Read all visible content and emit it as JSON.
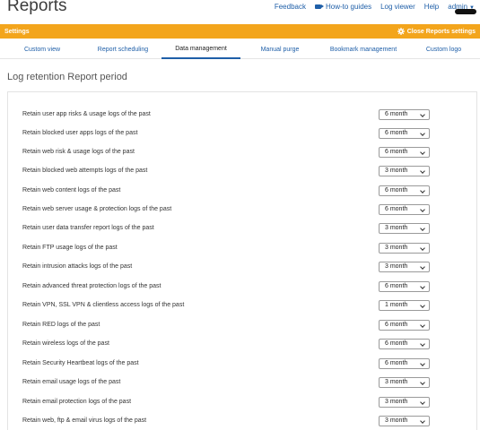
{
  "header": {
    "title": "Reports",
    "nav": {
      "feedback": "Feedback",
      "guides": "How-to guides",
      "log_viewer": "Log viewer",
      "help": "Help",
      "admin": "admin"
    }
  },
  "settings_bar": {
    "label": "Settings",
    "close_label": "Close Reports settings"
  },
  "tabs": [
    {
      "label": "Custom view"
    },
    {
      "label": "Report scheduling"
    },
    {
      "label": "Data management"
    },
    {
      "label": "Manual purge"
    },
    {
      "label": "Bookmark management"
    },
    {
      "label": "Custom logo"
    }
  ],
  "active_tab": "Data management",
  "section_title": "Log retention Report period",
  "retention_rows": [
    {
      "label": "Retain user app risks & usage logs of the past",
      "value": "6 month"
    },
    {
      "label": "Retain blocked user apps logs of the past",
      "value": "6 month"
    },
    {
      "label": "Retain web risk & usage logs of the past",
      "value": "6 month"
    },
    {
      "label": "Retain blocked web attempts logs of the past",
      "value": "3 month"
    },
    {
      "label": "Retain web content logs of the past",
      "value": "6 month"
    },
    {
      "label": "Retain web server usage & protection logs of the past",
      "value": "6 month"
    },
    {
      "label": "Retain user data transfer report logs of the past",
      "value": "3 month"
    },
    {
      "label": "Retain FTP usage logs of the past",
      "value": "3 month"
    },
    {
      "label": "Retain intrusion attacks logs of the past",
      "value": "3 month"
    },
    {
      "label": "Retain advanced threat protection logs of the past",
      "value": "6 month"
    },
    {
      "label": "Retain VPN, SSL VPN & clientless access logs of the past",
      "value": "1 month"
    },
    {
      "label": "Retain RED logs of the past",
      "value": "6 month"
    },
    {
      "label": "Retain wireless logs of the past",
      "value": "6 month"
    },
    {
      "label": "Retain Security Heartbeat logs of the past",
      "value": "6 month"
    },
    {
      "label": "Retain email usage logs of the past",
      "value": "3 month"
    },
    {
      "label": "Retain email protection logs of the past",
      "value": "3 month"
    },
    {
      "label": "Retain web, ftp & email virus logs of the past",
      "value": "3 month"
    }
  ]
}
